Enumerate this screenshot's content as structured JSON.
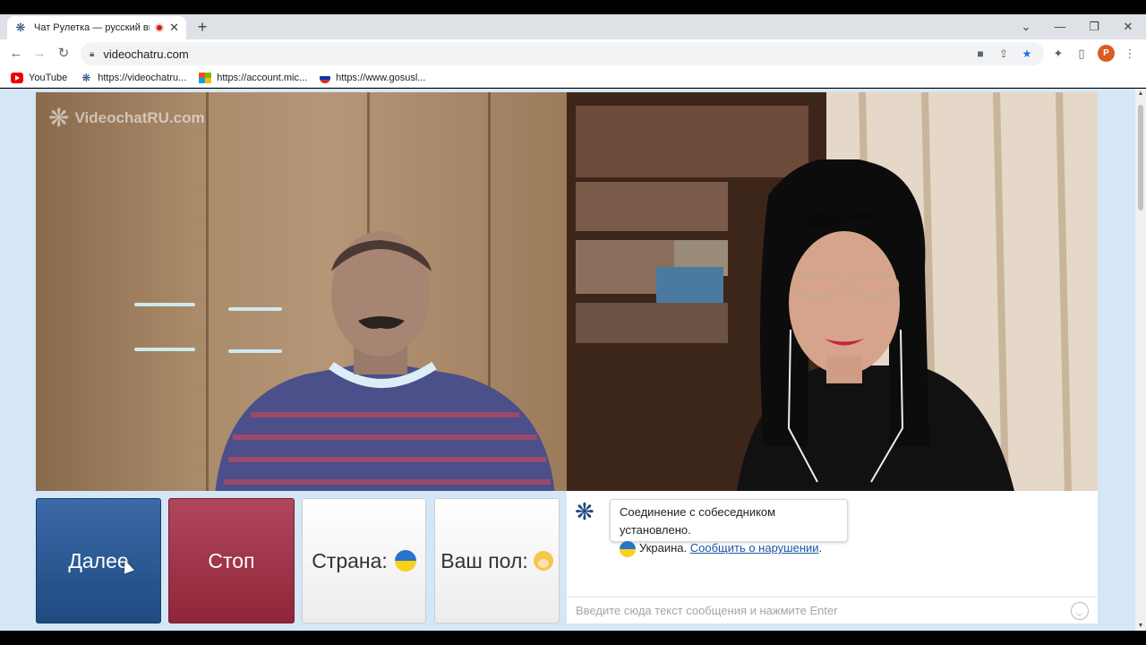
{
  "browser": {
    "tab": {
      "title": "Чат Рулетка — русский вид",
      "favicon": "videochat-icon",
      "recording": true
    },
    "address": "videochatru.com",
    "bookmarks": [
      {
        "label": "YouTube",
        "icon": "youtube-icon"
      },
      {
        "label": "https://videochatru...",
        "icon": "videochat-icon"
      },
      {
        "label": "https://account.mic...",
        "icon": "microsoft-icon"
      },
      {
        "label": "https://www.gosusl...",
        "icon": "gosuslugi-icon"
      }
    ],
    "profile_initial": "P"
  },
  "page": {
    "watermark": "VideochatRU.com",
    "buttons": {
      "next": "Далее",
      "stop": "Стоп",
      "country": "Страна:",
      "gender": "Ваш пол:"
    },
    "chat": {
      "system_message": "Соединение с собеседником установлено.",
      "country": "Украина.",
      "report_link": "Сообщить о нарушении",
      "report_suffix": ".",
      "input_placeholder": "Введите сюда текст сообщения и нажмите Enter"
    }
  },
  "colors": {
    "next_button": "#2a5a94",
    "stop_button": "#9e3549",
    "page_bg": "#d5e6f6"
  }
}
